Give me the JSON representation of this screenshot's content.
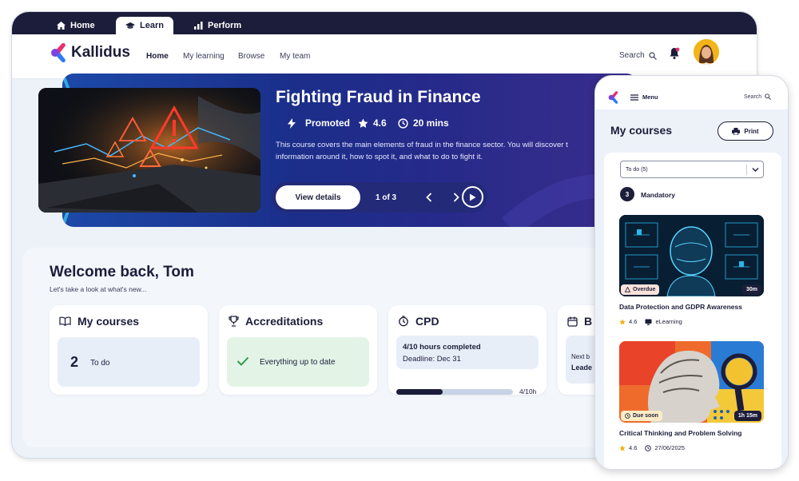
{
  "top_tabs": [
    {
      "label": "Home",
      "icon": "home-icon"
    },
    {
      "label": "Learn",
      "icon": "graduation-cap-icon"
    },
    {
      "label": "Perform",
      "icon": "bar-chart-icon"
    }
  ],
  "brand": {
    "name": "Kallidus",
    "color": "#1c1d3a",
    "logo_colors": [
      "#2f7bf5",
      "#e5326f"
    ]
  },
  "nav": {
    "links": [
      "Home",
      "My learning",
      "Browse",
      "My team"
    ],
    "active": "Home",
    "search_label": "Search"
  },
  "hero": {
    "title": "Fighting Fraud in Finance",
    "promoted": "Promoted",
    "rating": "4.6",
    "duration": "20 mins",
    "description": "This course covers the main elements of fraud in the finance sector. You will discover t information around it, how to spot it, and what to do to fight it.",
    "view_button": "View details",
    "page_indicator": "1 of 3"
  },
  "welcome": {
    "title": "Welcome back, Tom",
    "subtitle": "Let's take a look at what's new..."
  },
  "cards": {
    "my_courses": {
      "title": "My courses",
      "count": "2",
      "label": "To do"
    },
    "accreditations": {
      "title": "Accreditations",
      "status": "Everything up to date"
    },
    "cpd": {
      "title": "CPD",
      "hours": "4/10 hours completed",
      "deadline": "Deadline: Dec 31",
      "progress_label": "4/10h",
      "progress": 0.4
    },
    "partial": {
      "title": "B",
      "line1": "Next b",
      "line2": "Leade"
    }
  },
  "mobile": {
    "menu_label": "Menu",
    "search_label": "Search",
    "title": "My courses",
    "print_button": "Print",
    "filter_value": "To do (5)",
    "mandatory_count": "3",
    "mandatory_label": "Mandatory",
    "courses": [
      {
        "title": "Data Protection and GDPR Awareness",
        "badge": "Overdue",
        "duration": "30m",
        "rating": "4.6",
        "type": "eLearning"
      },
      {
        "title": "Critical Thinking and Problem Solving",
        "badge": "Due soon",
        "duration": "1h 15m",
        "rating": "4.6",
        "date": "27/06/2025"
      }
    ]
  },
  "colors": {
    "navy": "#1c1d3a",
    "hero_blue": "#1b2e8a",
    "success_green": "#2e9a4f",
    "overdue_bg": "#fde2dc",
    "due_soon_bg": "#fbecc7",
    "star": "#f2b418"
  }
}
